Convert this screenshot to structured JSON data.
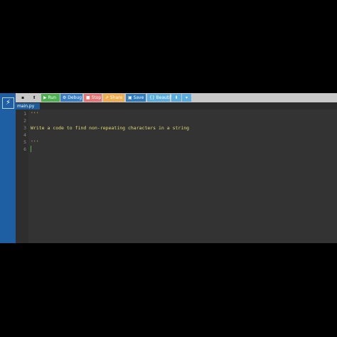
{
  "sidebar": {
    "logo_icon": "lightning-icon"
  },
  "toolbar": {
    "new_icon": "file-icon",
    "upload_icon": "upload-icon",
    "run": "▶ Run",
    "debug": "⚙ Debug",
    "stop": "■ Stop",
    "share": "⇗ Share",
    "save": "▣ Save",
    "beautify": "{} Beautify",
    "download": "⬇",
    "dropdown": "▾",
    "colors": {
      "run": "#4caf50",
      "debug": "#3a7ec4",
      "stop": "#e57373",
      "share": "#f0ad4e",
      "save": "#2e7dbf",
      "beautify": "#5aaee0",
      "download": "#5aaee0"
    }
  },
  "tabs": [
    {
      "label": "main.py"
    }
  ],
  "editor": {
    "line_numbers": [
      "1",
      "2",
      "3",
      "4",
      "5",
      "6"
    ],
    "lines": [
      "'''",
      "",
      "Write a code to find non-repeating characters in a string",
      "",
      "'''",
      ""
    ]
  }
}
